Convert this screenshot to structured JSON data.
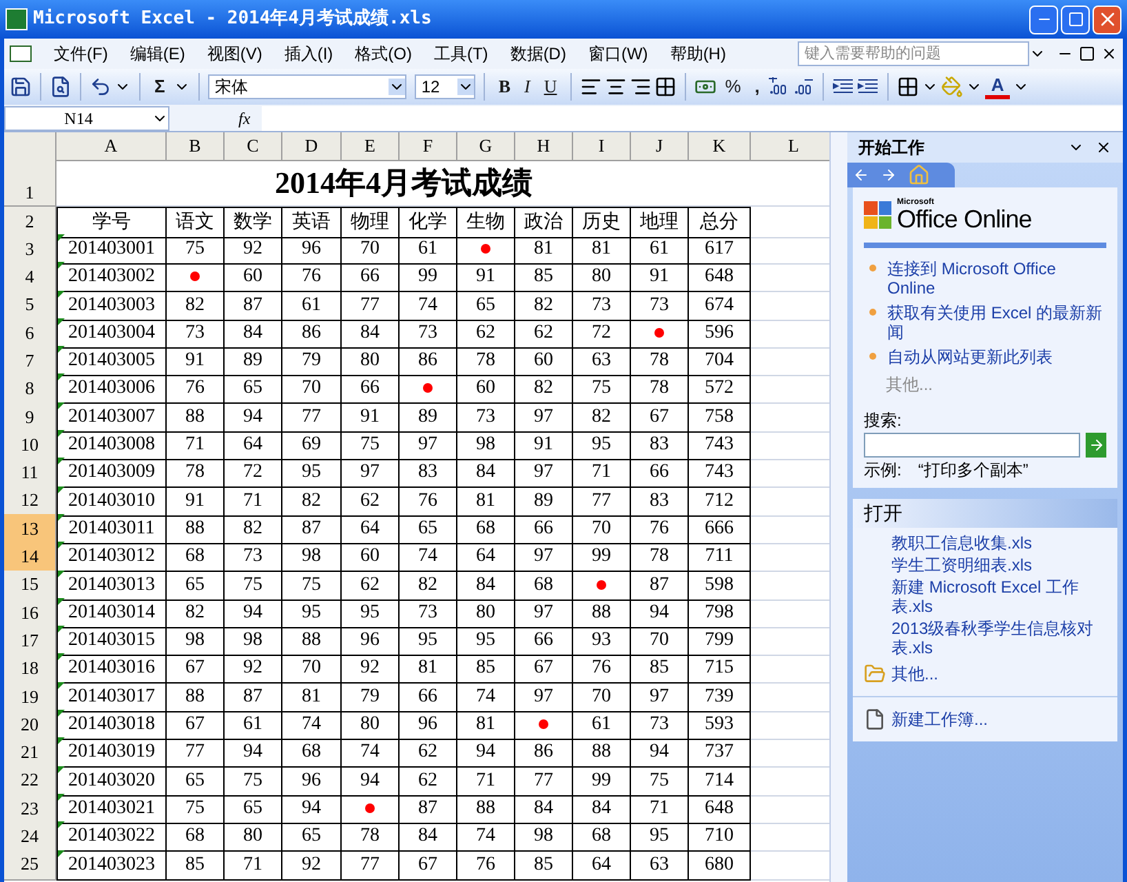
{
  "window": {
    "title": "Microsoft Excel - 2014年4月考试成绩.xls"
  },
  "menu": [
    "文件(F)",
    "编辑(E)",
    "视图(V)",
    "插入(I)",
    "格式(O)",
    "工具(T)",
    "数据(D)",
    "窗口(W)",
    "帮助(H)"
  ],
  "help_search": {
    "placeholder": "键入需要帮助的问题"
  },
  "toolbar": {
    "autosum": "Σ",
    "font": "宋体",
    "size": "12",
    "bold": "B",
    "italic": "I",
    "underline": "U",
    "percent": "%",
    "comma": ",",
    "font_color": "A"
  },
  "name_box": "N14",
  "formula_label": "fx",
  "sheet": {
    "columns": [
      "A",
      "B",
      "C",
      "D",
      "E",
      "F",
      "G",
      "H",
      "I",
      "J",
      "K",
      "L"
    ],
    "title_row": {
      "number": "1",
      "text": "2014年4月考试成绩"
    },
    "header_row": {
      "number": "2",
      "cells": [
        "学号",
        "语文",
        "数学",
        "英语",
        "物理",
        "化学",
        "生物",
        "政治",
        "历史",
        "地理",
        "总分"
      ]
    },
    "rows": [
      {
        "number": "3",
        "selected": false,
        "cells": [
          "201403001",
          "75",
          "92",
          "96",
          "70",
          "61",
          {
            "kind": "dot"
          },
          "81",
          "81",
          "61",
          "617"
        ]
      },
      {
        "number": "4",
        "selected": false,
        "cells": [
          "201403002",
          {
            "kind": "dot"
          },
          "60",
          "76",
          "66",
          "99",
          "91",
          "85",
          "80",
          "91",
          "648"
        ]
      },
      {
        "number": "5",
        "selected": false,
        "cells": [
          "201403003",
          "82",
          "87",
          "61",
          "77",
          "74",
          "65",
          "82",
          "73",
          "73",
          "674"
        ]
      },
      {
        "number": "6",
        "selected": false,
        "cells": [
          "201403004",
          "73",
          "84",
          "86",
          "84",
          "73",
          "62",
          "62",
          "72",
          {
            "kind": "dot"
          },
          "596"
        ]
      },
      {
        "number": "7",
        "selected": false,
        "cells": [
          "201403005",
          "91",
          "89",
          "79",
          "80",
          "86",
          "78",
          "60",
          "63",
          "78",
          "704"
        ]
      },
      {
        "number": "8",
        "selected": false,
        "cells": [
          "201403006",
          "76",
          "65",
          "70",
          "66",
          {
            "kind": "dot"
          },
          "60",
          "82",
          "75",
          "78",
          "572"
        ]
      },
      {
        "number": "9",
        "selected": false,
        "cells": [
          "201403007",
          "88",
          "94",
          "77",
          "91",
          "89",
          "73",
          "97",
          "82",
          "67",
          "758"
        ]
      },
      {
        "number": "10",
        "selected": false,
        "cells": [
          "201403008",
          "71",
          "64",
          "69",
          "75",
          "97",
          "98",
          "91",
          "95",
          "83",
          "743"
        ]
      },
      {
        "number": "11",
        "selected": false,
        "cells": [
          "201403009",
          "78",
          "72",
          "95",
          "97",
          "83",
          "84",
          "97",
          "71",
          "66",
          "743"
        ]
      },
      {
        "number": "12",
        "selected": false,
        "cells": [
          "201403010",
          "91",
          "71",
          "82",
          "62",
          "76",
          "81",
          "89",
          "77",
          "83",
          "712"
        ]
      },
      {
        "number": "13",
        "selected": true,
        "cells": [
          "201403011",
          "88",
          "82",
          "87",
          "64",
          "65",
          "68",
          "66",
          "70",
          "76",
          "666"
        ]
      },
      {
        "number": "14",
        "selected": true,
        "cells": [
          "201403012",
          "68",
          "73",
          "98",
          "60",
          "74",
          "64",
          "97",
          "99",
          "78",
          "711"
        ]
      },
      {
        "number": "15",
        "selected": false,
        "cells": [
          "201403013",
          "65",
          "75",
          "75",
          "62",
          "82",
          "84",
          "68",
          {
            "kind": "dot"
          },
          "87",
          "598"
        ]
      },
      {
        "number": "16",
        "selected": false,
        "cells": [
          "201403014",
          "82",
          "94",
          "95",
          "95",
          "73",
          "80",
          "97",
          "88",
          "94",
          "798"
        ]
      },
      {
        "number": "17",
        "selected": false,
        "cells": [
          "201403015",
          "98",
          "98",
          "88",
          "96",
          "95",
          "95",
          "66",
          "93",
          "70",
          "799"
        ]
      },
      {
        "number": "18",
        "selected": false,
        "cells": [
          "201403016",
          "67",
          "92",
          "70",
          "92",
          "81",
          "85",
          "67",
          "76",
          "85",
          "715"
        ]
      },
      {
        "number": "19",
        "selected": false,
        "cells": [
          "201403017",
          "88",
          "87",
          "81",
          "79",
          "66",
          "74",
          "97",
          "70",
          "97",
          "739"
        ]
      },
      {
        "number": "20",
        "selected": false,
        "cells": [
          "201403018",
          "67",
          "61",
          "74",
          "80",
          "96",
          "81",
          {
            "kind": "dot"
          },
          "61",
          "73",
          "593"
        ]
      },
      {
        "number": "21",
        "selected": false,
        "cells": [
          "201403019",
          "77",
          "94",
          "68",
          "74",
          "62",
          "94",
          "86",
          "88",
          "94",
          "737"
        ]
      },
      {
        "number": "22",
        "selected": false,
        "cells": [
          "201403020",
          "65",
          "75",
          "96",
          "94",
          "62",
          "71",
          "77",
          "99",
          "75",
          "714"
        ]
      },
      {
        "number": "23",
        "selected": false,
        "cells": [
          "201403021",
          "75",
          "65",
          "94",
          {
            "kind": "dot"
          },
          "87",
          "88",
          "84",
          "84",
          "71",
          "648"
        ]
      },
      {
        "number": "24",
        "selected": false,
        "cells": [
          "201403022",
          "68",
          "80",
          "65",
          "78",
          "84",
          "74",
          "98",
          "68",
          "95",
          "710"
        ]
      },
      {
        "number": "25",
        "selected": false,
        "cells": [
          "201403023",
          "85",
          "71",
          "92",
          "77",
          "67",
          "76",
          "85",
          "64",
          "63",
          "680"
        ]
      }
    ]
  },
  "task_pane": {
    "title": "开始工作",
    "logo": {
      "small": "Microsoft",
      "large": "Office Online"
    },
    "links": [
      "连接到 Microsoft Office Online",
      "获取有关使用 Excel 的最新新闻",
      "自动从网站更新此列表"
    ],
    "more": "其他...",
    "search_label": "搜索:",
    "example_label": "示例:",
    "example": "“打印多个副本”",
    "open_section": {
      "title": "打开",
      "files": [
        "教职工信息收集.xls",
        "学生工资明细表.xls",
        "新建 Microsoft Excel 工作表.xls",
        "2013级春秋季学生信息核对表.xls"
      ],
      "more": "其他..."
    },
    "new_workbook": "新建工作簿..."
  }
}
